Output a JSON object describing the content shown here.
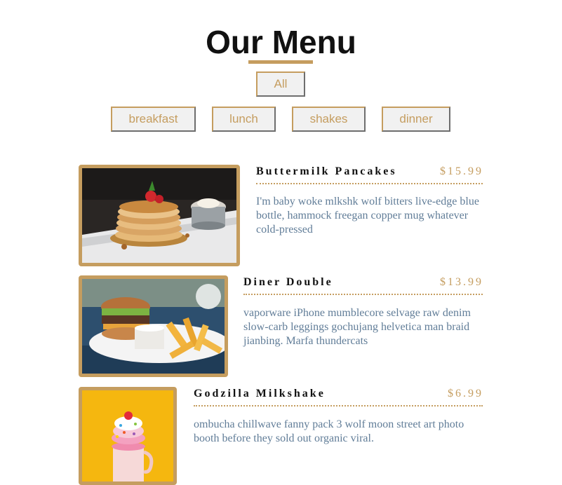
{
  "header": {
    "title": "Our Menu"
  },
  "filters": {
    "all": "All",
    "categories": [
      "breakfast",
      "lunch",
      "shakes",
      "dinner"
    ]
  },
  "colors": {
    "accent": "#c59d5f",
    "description": "#617d98",
    "heading": "#111111"
  },
  "menu": [
    {
      "name": "Buttermilk Pancakes",
      "price": "$15.99",
      "description": "I'm baby woke mlkshk wolf bitters live-edge blue bottle, hammock freegan copper mug whatever cold-pressed"
    },
    {
      "name": "Diner Double",
      "price": "$13.99",
      "description": "vaporware iPhone mumblecore selvage raw denim slow-carb leggings gochujang helvetica man braid jianbing. Marfa thundercats"
    },
    {
      "name": "Godzilla Milkshake",
      "price": "$6.99",
      "description": "ombucha chillwave fanny pack 3 wolf moon street art photo booth before they sold out organic viral."
    }
  ]
}
